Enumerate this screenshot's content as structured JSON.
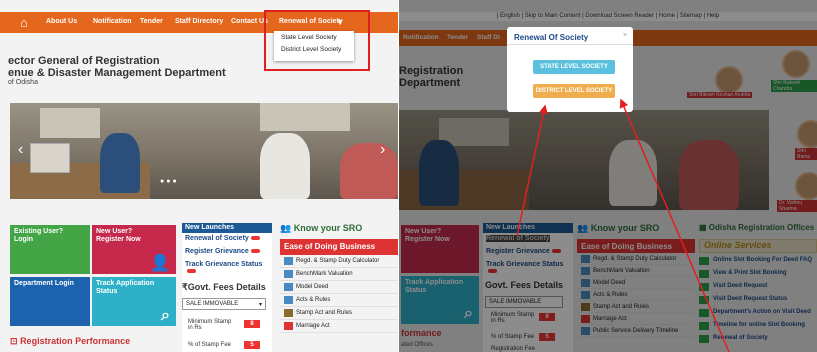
{
  "left": {
    "nav": {
      "home_icon": "home-icon",
      "items": [
        "About Us",
        "Notification",
        "Tender",
        "Staff Directory",
        "Contact Us",
        "Renewal of Society"
      ]
    },
    "dropdown": [
      "State Level Society",
      "District Level Society"
    ],
    "title_line1": "ector General of Registration",
    "title_line2": "enue & Disaster Management Department",
    "title_line3": "of Odisha",
    "tiles": [
      {
        "label": "Existing User?\nLogin"
      },
      {
        "label": "New User?\nRegister Now"
      },
      {
        "label": "Department Login"
      },
      {
        "label": "Track Application\nStatus"
      }
    ],
    "launches": {
      "header": "New Launches",
      "items": [
        "Renewal of Society",
        "Register Grievance",
        "Track Grievance Status"
      ]
    },
    "fees": {
      "title": "₹Govt. Fees Details",
      "select": "SALE IMMOVABLE",
      "rows": [
        {
          "label": "Minimum Stamp\nin Rs",
          "value": "8"
        },
        {
          "label": "% of Stamp Fee",
          "value": "5"
        }
      ]
    },
    "sro": {
      "title": "Know your SRO",
      "ease": "Ease of Doing Business",
      "items": [
        "Regd. & Stamp Duty Calculator",
        "BenchMark Valuation",
        "Model Deed",
        "Acts & Rules",
        "Stamp Act and Rules",
        "Marriage Act"
      ]
    },
    "performance": "Registration Performance"
  },
  "right": {
    "access": "| English | Skip to Main Content | Download Screen Reader | Home | Sitemap | Help",
    "nav": [
      "Notification",
      "Tender",
      "Staff Di"
    ],
    "title1": "Registration",
    "title2": "Department",
    "modal": {
      "title": "Renewal Of Society",
      "close": "×",
      "btn1": "STATE LEVEL SOCIETY",
      "btn2": "DISTRICT LEVEL SOCIETY"
    },
    "tiles": [
      "New User?\nRegister Now",
      "Track Application\nStatus"
    ],
    "launches": {
      "header": "New Launches",
      "items": [
        "Renewal of Society",
        "Register Grievance",
        "Track Grievance Status"
      ]
    },
    "fees": {
      "title": "Govt. Fees Details",
      "select": "SALE IMMOVABLE",
      "rows": [
        {
          "label": "Minimum Stamp\nin Rs",
          "value": "8"
        },
        {
          "label": "% of Stamp Fee",
          "value": "5"
        },
        {
          "label": "Registration Fee",
          "value": ""
        }
      ]
    },
    "sro": {
      "title": "Know your SRO",
      "ease": "Ease of Doing Business",
      "items": [
        "Regd. & Stamp Duty Calculator",
        "BenchMark Valuation",
        "Model Deed",
        "Acts & Rules",
        "Stamp Act and Rules",
        "Marriage Act",
        "Public Service Delivery Timeline"
      ]
    },
    "perf": "formance",
    "perf2": "ated Offices",
    "offices": {
      "title": "Odisha Registration Offices",
      "online": "Online Services",
      "items": [
        "Online Slot Booking For Deed",
        "View & Print Slot Booking",
        "Visit Deed Request",
        "Visit Deed Request Status",
        "Department's Action on Visit Deed",
        "Timeline for online Slot Booking",
        "Renewal of Society"
      ],
      "faq": "FAQ"
    },
    "officers": [
      "Shri Bikram Keshari Arukha",
      "Shri Rakesh Chandra",
      "Shri Bama",
      "Dr. Vishnu Sharma"
    ]
  },
  "colors": {
    "nav": "#e5671d",
    "red": "#e02020",
    "blue": "#1c5a96",
    "green": "#2a6e36"
  }
}
